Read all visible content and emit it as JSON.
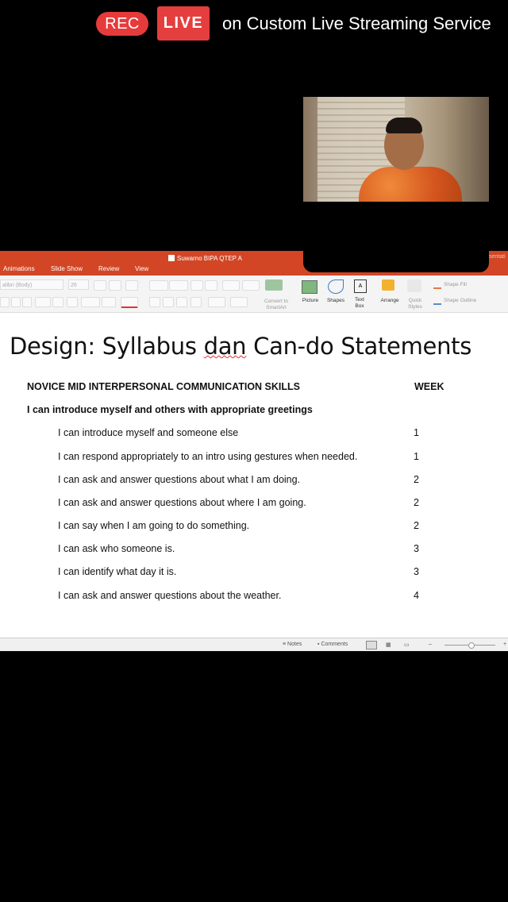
{
  "stream": {
    "rec_label": "REC",
    "live_label": "LIVE",
    "service_text": "on Custom Live Streaming Service",
    "rec_color": "#e63b3b",
    "live_color": "#e53e3e"
  },
  "powerpoint": {
    "ribbon_color": "#d24625",
    "document_title": "Suwarno BIPA QTEP A",
    "truncated_right_text": "sentati",
    "tabs": [
      "Animations",
      "Slide Show",
      "Review",
      "View"
    ],
    "toolbar": {
      "font_name": "alibri (Body)",
      "font_size": "26",
      "labels": {
        "convert_smartart": [
          "Convert to",
          "SmartArt"
        ],
        "picture": "Picture",
        "shapes": "Shapes",
        "text_box": [
          "Text",
          "Box"
        ],
        "arrange": "Arrange",
        "quick_styles": [
          "Quick",
          "Styles"
        ],
        "shape_fill": "Shape Fill",
        "shape_outline": "Shape Outline"
      }
    },
    "slide": {
      "title_part1": "Design: Syllabus ",
      "title_underlined": "dan",
      "title_part2": " Can-do Statements",
      "column_header": "NOVICE MID INTERPERSONAL COMMUNICATION SKILLS",
      "week_header": "WEEK",
      "section_heading": "I can introduce myself and others with appropriate greetings",
      "rows": [
        {
          "text": "I can introduce myself and someone else",
          "week": "1"
        },
        {
          "text": "I can respond appropriately to an intro using gestures when needed.",
          "week": "1"
        },
        {
          "text": "I can ask and answer questions about what I am doing.",
          "week": "2"
        },
        {
          "text": "I can ask and answer questions about where I am going.",
          "week": "2"
        },
        {
          "text": "I can say when I am going to do something.",
          "week": "2"
        },
        {
          "text": "I can ask who someone is.",
          "week": "3"
        },
        {
          "text": "I can identify what day it is.",
          "week": "3"
        },
        {
          "text": "I can ask and answer questions about the weather.",
          "week": "4"
        }
      ]
    },
    "statusbar": {
      "notes": "Notes",
      "comments": "Comments"
    }
  }
}
